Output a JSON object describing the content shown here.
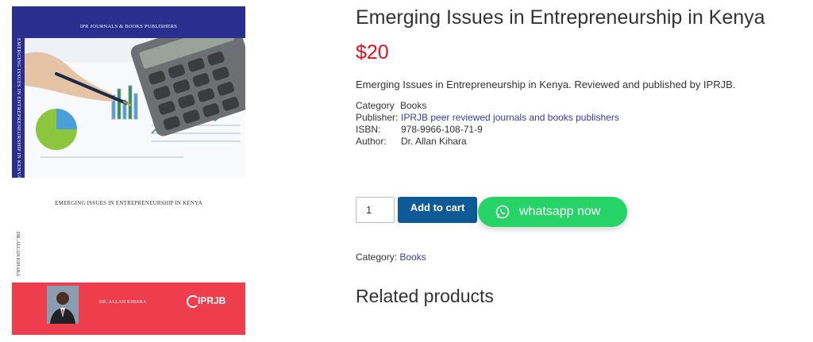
{
  "cover": {
    "publisher": "IPR JOURNALS & BOOKS PUBLISHERS",
    "spine_top": "EMERGING ISSUES IN ENTREPRENEURSHIP IN KENYA",
    "title": "EMERGING ISSUES IN ENTREPRENEURSHIP IN KENYA",
    "spine_bottom": "DR. ALLAN KIHARA",
    "author": "DR. ALLAN KIHARA",
    "logo": "IPRJB",
    "colors": {
      "top": "#2a2f8f",
      "band": "#ee3e4e"
    }
  },
  "product": {
    "title": "Emerging Issues in Entrepreneurship in Kenya",
    "price": "$20",
    "short_description": "Emerging Issues in Entrepreneurship in Kenya. Reviewed and published by IPRJB.",
    "meta": {
      "category_label": "Category",
      "category_value": "Books",
      "publisher_label": "Publisher:",
      "publisher_value": "IPRJB peer reviewed journals and books publishers",
      "isbn_label": "ISBN:",
      "isbn_value": "978-9966-108-71-9",
      "author_label": "Author:",
      "author_value": "Dr. Allan Kihara"
    }
  },
  "cart": {
    "quantity": "1",
    "add_to_cart_label": "Add to cart",
    "whatsapp_label": "whatsapp now",
    "whatsapp_icon": "whatsapp-icon"
  },
  "category_line": {
    "label": "Category:",
    "link": "Books"
  },
  "related": {
    "heading": "Related products"
  },
  "colors": {
    "price": "#e3101e",
    "add_to_cart": "#0d5a96",
    "whatsapp": "#25d366",
    "link": "#3a3aa8"
  }
}
